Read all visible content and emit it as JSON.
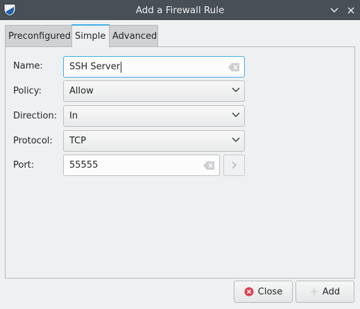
{
  "window": {
    "title": "Add a Firewall Rule"
  },
  "tabs": [
    {
      "label": "Preconfigured"
    },
    {
      "label": "Simple"
    },
    {
      "label": "Advanced"
    }
  ],
  "form": {
    "name": {
      "label": "Name:",
      "value": "SSH Server"
    },
    "policy": {
      "label": "Policy:",
      "value": "Allow"
    },
    "direction": {
      "label": "Direction:",
      "value": "In"
    },
    "protocol": {
      "label": "Protocol:",
      "value": "TCP"
    },
    "port": {
      "label": "Port:",
      "value": "55555"
    }
  },
  "buttons": {
    "close": "Close",
    "add": "Add"
  },
  "colors": {
    "titlebar": "#475057",
    "accent": "#3daee9",
    "close_icon": "#da4453"
  }
}
